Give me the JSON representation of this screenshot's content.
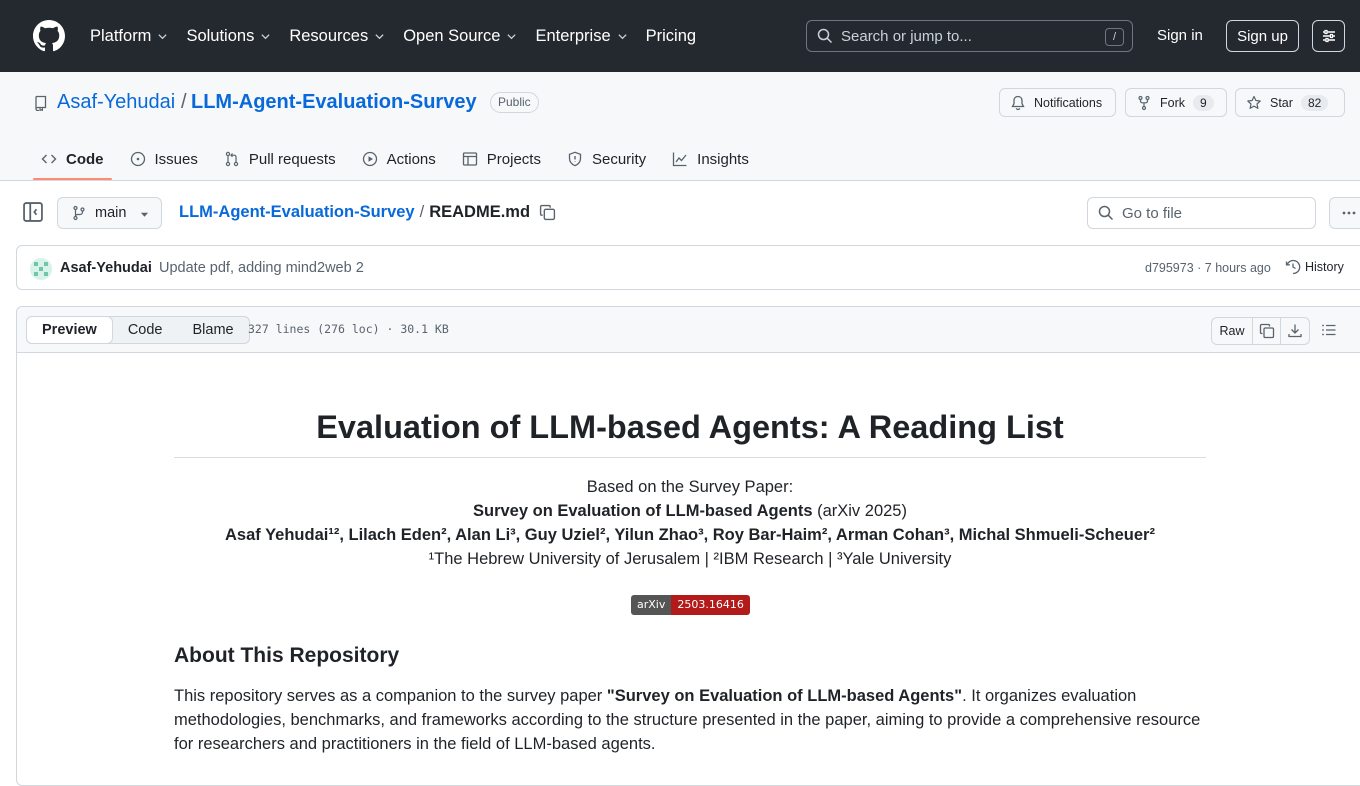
{
  "topnav": {
    "items": [
      {
        "label": "Platform",
        "dropdown": true
      },
      {
        "label": "Solutions",
        "dropdown": true
      },
      {
        "label": "Resources",
        "dropdown": true
      },
      {
        "label": "Open Source",
        "dropdown": true
      },
      {
        "label": "Enterprise",
        "dropdown": true
      },
      {
        "label": "Pricing",
        "dropdown": false
      }
    ],
    "search_placeholder": "Search or jump to...",
    "search_shortcut": "/",
    "signin": "Sign in",
    "signup": "Sign up"
  },
  "repo": {
    "owner": "Asaf-Yehudai",
    "separator": "/",
    "name": "LLM-Agent-Evaluation-Survey",
    "visibility": "Public",
    "notifications_label": "Notifications",
    "fork_label": "Fork",
    "fork_count": "9",
    "star_label": "Star",
    "star_count": "82",
    "tabs": [
      {
        "label": "Code",
        "icon": "code-icon",
        "active": true
      },
      {
        "label": "Issues",
        "icon": "issue-icon",
        "active": false
      },
      {
        "label": "Pull requests",
        "icon": "pull-request-icon",
        "active": false
      },
      {
        "label": "Actions",
        "icon": "play-icon",
        "active": false
      },
      {
        "label": "Projects",
        "icon": "table-icon",
        "active": false
      },
      {
        "label": "Security",
        "icon": "shield-icon",
        "active": false
      },
      {
        "label": "Insights",
        "icon": "graph-icon",
        "active": false
      }
    ]
  },
  "filenav": {
    "branch": "main",
    "breadcrumb_repo": "LLM-Agent-Evaluation-Survey",
    "breadcrumb_sep": "/",
    "breadcrumb_file": "README.md",
    "goto_placeholder": "Go to file"
  },
  "commit": {
    "author": "Asaf-Yehudai",
    "message": "Update pdf, adding mind2web 2",
    "meta": "d795973 · 7 hours ago",
    "history_label": "History"
  },
  "file": {
    "views": [
      "Preview",
      "Code",
      "Blame"
    ],
    "active_view": "Preview",
    "info": "327 lines (276 loc) · 30.1 KB",
    "raw_label": "Raw"
  },
  "readme": {
    "title": "Evaluation of LLM-based Agents: A Reading List",
    "based_on": "Based on the Survey Paper:",
    "paper_title": "Survey on Evaluation of LLM-based Agents",
    "paper_venue": " (arXiv 2025)",
    "authors": "Asaf Yehudai¹², Lilach Eden², Alan Li³, Guy Uziel², Yilun Zhao³, Roy Bar-Haim², Arman Cohan³, Michal Shmueli-Scheuer²",
    "affiliations": "¹The Hebrew University of Jerusalem | ²IBM Research | ³Yale University",
    "badge_left": "arXiv",
    "badge_right": "2503.16416",
    "about_heading": "About This Repository",
    "about_p_prefix": "This repository serves as a companion to the survey paper ",
    "about_p_bold": "\"Survey on Evaluation of LLM-based Agents\"",
    "about_p_suffix": ". It organizes evaluation methodologies, benchmarks, and frameworks according to the structure presented in the paper, aiming to provide a comprehensive resource for researchers and practitioners in the field of LLM-based agents."
  },
  "colors": {
    "header_bg": "#24292f",
    "link": "#0969da",
    "active_tab_underline": "#fd8c73",
    "badge_red": "#b31b1b"
  }
}
